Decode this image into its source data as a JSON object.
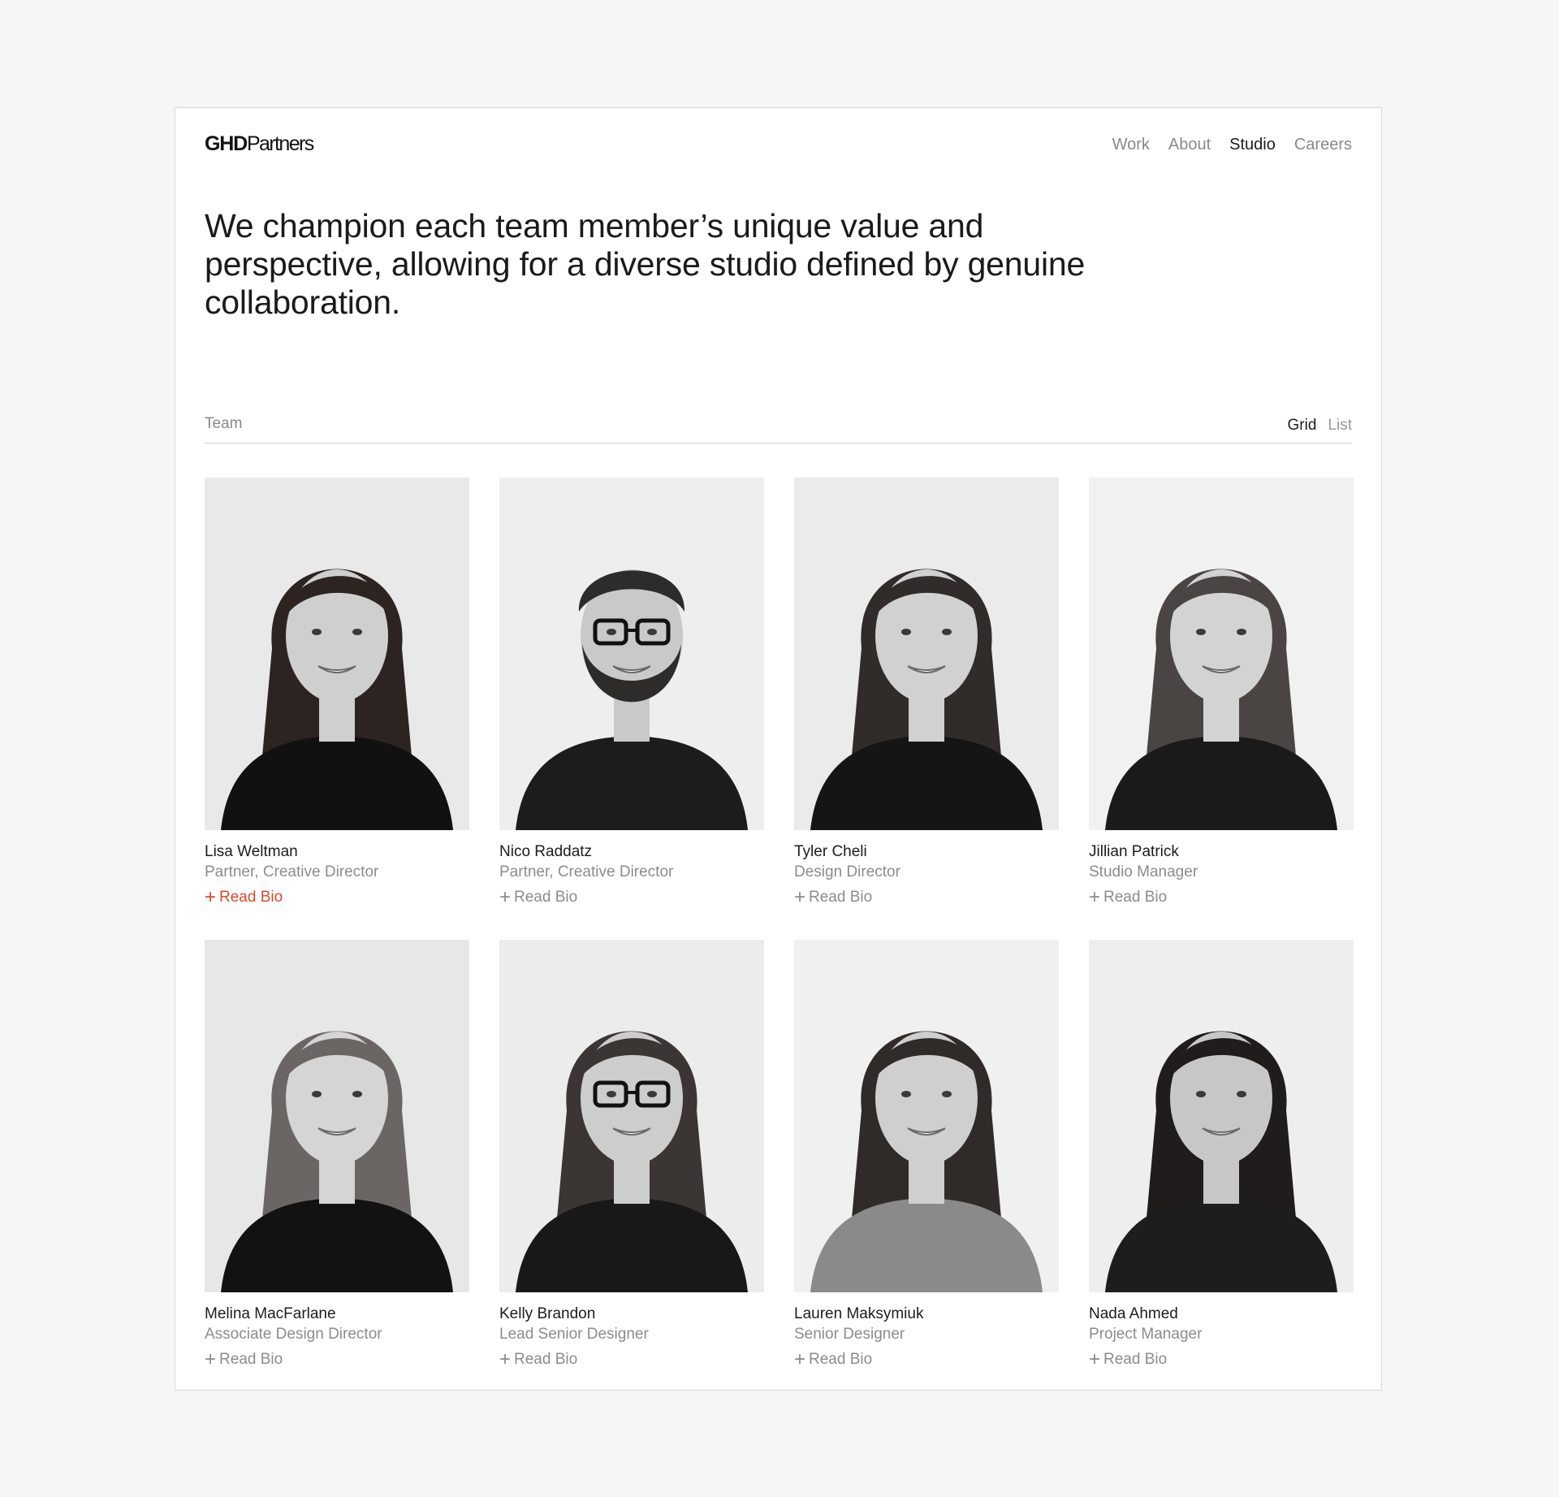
{
  "logo": {
    "bold": "GHD",
    "light": "Partners"
  },
  "nav": [
    {
      "label": "Work",
      "active": false
    },
    {
      "label": "About",
      "active": false
    },
    {
      "label": "Studio",
      "active": true
    },
    {
      "label": "Careers",
      "active": false
    }
  ],
  "hero": {
    "text": "We champion each team member’s unique value and perspective, allowing for a diverse studio defined by genuine collaboration."
  },
  "section": {
    "label": "Team",
    "views": [
      {
        "label": "Grid",
        "active": true
      },
      {
        "label": "List",
        "active": false
      }
    ]
  },
  "bio_label": "Read Bio",
  "plus_symbol": "+",
  "highlight_color": "#e0492e",
  "team": [
    {
      "name": "Lisa Weltman",
      "role": "Partner, Creative Director",
      "hovered": true
    },
    {
      "name": "Nico Raddatz",
      "role": "Partner, Creative Director",
      "hovered": false
    },
    {
      "name": "Tyler Cheli",
      "role": "Design Director",
      "hovered": false
    },
    {
      "name": "Jillian Patrick",
      "role": "Studio Manager",
      "hovered": false
    },
    {
      "name": "Melina MacFarlane",
      "role": "Associate Design Director",
      "hovered": false
    },
    {
      "name": "Kelly Brandon",
      "role": "Lead Senior Designer",
      "hovered": false
    },
    {
      "name": "Lauren Maksymiuk",
      "role": "Senior Designer",
      "hovered": false
    },
    {
      "name": "Nada Ahmed",
      "role": "Project Manager",
      "hovered": false
    }
  ]
}
